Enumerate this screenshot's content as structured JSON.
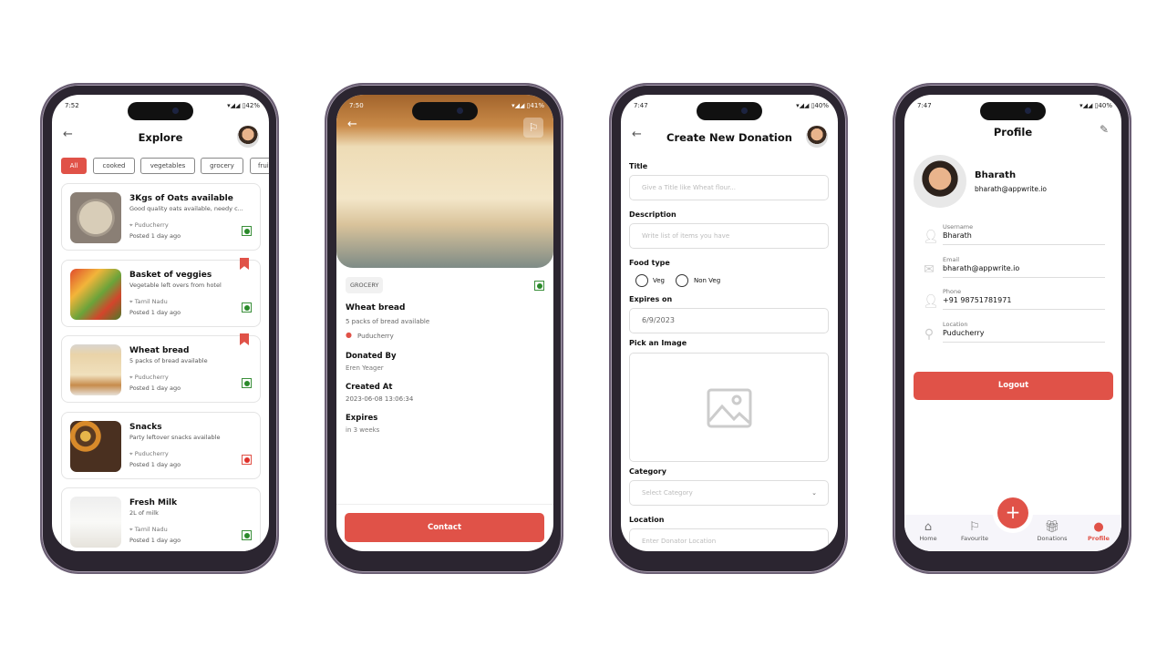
{
  "colors": {
    "accent": "#e05248",
    "veg": "#2a8a2a",
    "nonveg": "#e0302a"
  },
  "explore": {
    "time": "7:52",
    "status": "▾◢◢ ▯42%",
    "title": "Explore",
    "chips": [
      "All",
      "cooked",
      "vegetables",
      "grocery",
      "fruits"
    ],
    "cards": [
      {
        "title": "3Kgs of Oats available",
        "desc": "Good quality oats available, needy c...",
        "location": "Puducherry",
        "posted": "Posted 1 day ago",
        "type": "veg",
        "bookmarked": false
      },
      {
        "title": "Basket of veggies",
        "desc": "Vegetable left overs from hotel",
        "location": "Tamil Nadu",
        "posted": "Posted 1 day ago",
        "type": "veg",
        "bookmarked": true
      },
      {
        "title": "Wheat bread",
        "desc": "5 packs of bread available",
        "location": "Puducherry",
        "posted": "Posted 1 day ago",
        "type": "veg",
        "bookmarked": true
      },
      {
        "title": "Snacks",
        "desc": "Party leftover snacks available",
        "location": "Puducherry",
        "posted": "Posted 1 day ago",
        "type": "nonveg",
        "bookmarked": false
      },
      {
        "title": "Fresh Milk",
        "desc": "2L of milk",
        "location": "Tamil Nadu",
        "posted": "Posted 1 day ago",
        "type": "veg",
        "bookmarked": false
      }
    ]
  },
  "detail": {
    "time": "7:50",
    "status": "▾◢◢ ▯41%",
    "category": "GROCERY",
    "title": "Wheat bread",
    "desc": "5 packs of bread available",
    "location": "Puducherry",
    "donated_by_label": "Donated By",
    "donated_by": "Eren Yeager",
    "created_label": "Created At",
    "created": "2023-06-08 13:06:34",
    "expires_label": "Expires",
    "expires": "in 3 weeks",
    "contact": "Contact"
  },
  "create": {
    "time": "7:47",
    "status": "▾◢◢ ▯40%",
    "title": "Create New Donation",
    "title_label": "Title",
    "title_placeholder": "Give a Title like Wheat flour...",
    "desc_label": "Description",
    "desc_placeholder": "Write list of items you have",
    "food_type_label": "Food type",
    "veg": "Veg",
    "nonveg": "Non Veg",
    "expires_label": "Expires on",
    "expires_value": "6/9/2023",
    "image_label": "Pick an Image",
    "category_label": "Category",
    "category_placeholder": "Select Category",
    "location_label": "Location",
    "location_placeholder": "Enter Donator Location"
  },
  "profile": {
    "time": "7:47",
    "status": "▾◢◢ ▯40%",
    "title": "Profile",
    "name": "Bharath",
    "email": "bharath@appwrite.io",
    "fields": [
      {
        "label": "Username",
        "value": "Bharath"
      },
      {
        "label": "Email",
        "value": "bharath@appwrite.io"
      },
      {
        "label": "Phone",
        "value": "+91 98751781971"
      },
      {
        "label": "Location",
        "value": "Puducherry"
      }
    ],
    "logout": "Logout",
    "nav": [
      "Home",
      "Favourite",
      "Donations",
      "Profile"
    ]
  }
}
